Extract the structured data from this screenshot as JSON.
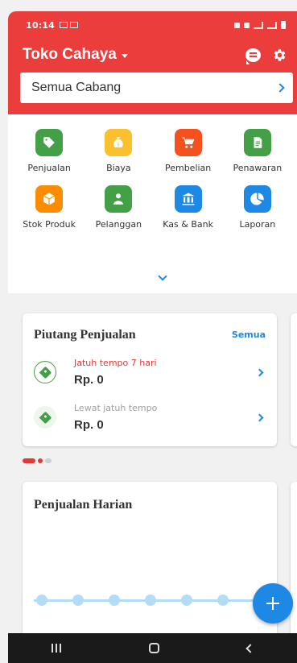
{
  "status_bar": {
    "time": "10:14"
  },
  "header": {
    "store_name": "Toko Cahaya",
    "branch_selector": "Semua Cabang",
    "accent_color": "#ec3d3d"
  },
  "menu": [
    {
      "label": "Penjualan",
      "icon": "price-tag-icon",
      "color": "#43a047"
    },
    {
      "label": "Biaya",
      "icon": "money-bag-icon",
      "color": "#fbc02d"
    },
    {
      "label": "Pembelian",
      "icon": "shopping-cart-icon",
      "color": "#f4511e"
    },
    {
      "label": "Penawaran",
      "icon": "quote-document-icon",
      "color": "#43a047"
    },
    {
      "label": "Stok Produk",
      "icon": "box-icon",
      "color": "#fb8c00"
    },
    {
      "label": "Pelanggan",
      "icon": "customers-icon",
      "color": "#43a047"
    },
    {
      "label": "Kas & Bank",
      "icon": "bank-icon",
      "color": "#1e88e5"
    },
    {
      "label": "Laporan",
      "icon": "pie-chart-icon",
      "color": "#1e88e5"
    }
  ],
  "receivables": {
    "title": "Piutang Penjualan",
    "see_all": "Semua",
    "rows": [
      {
        "label": "Jatuh tempo 7 hari",
        "amount": "Rp. 0"
      },
      {
        "label": "Lewat jatuh tempo",
        "amount": "Rp. 0"
      }
    ]
  },
  "daily_sales": {
    "title": "Penjualan Harian",
    "points": 7
  },
  "colors": {
    "primary": "#1e88e5",
    "success": "#43a047",
    "danger": "#e53935"
  }
}
